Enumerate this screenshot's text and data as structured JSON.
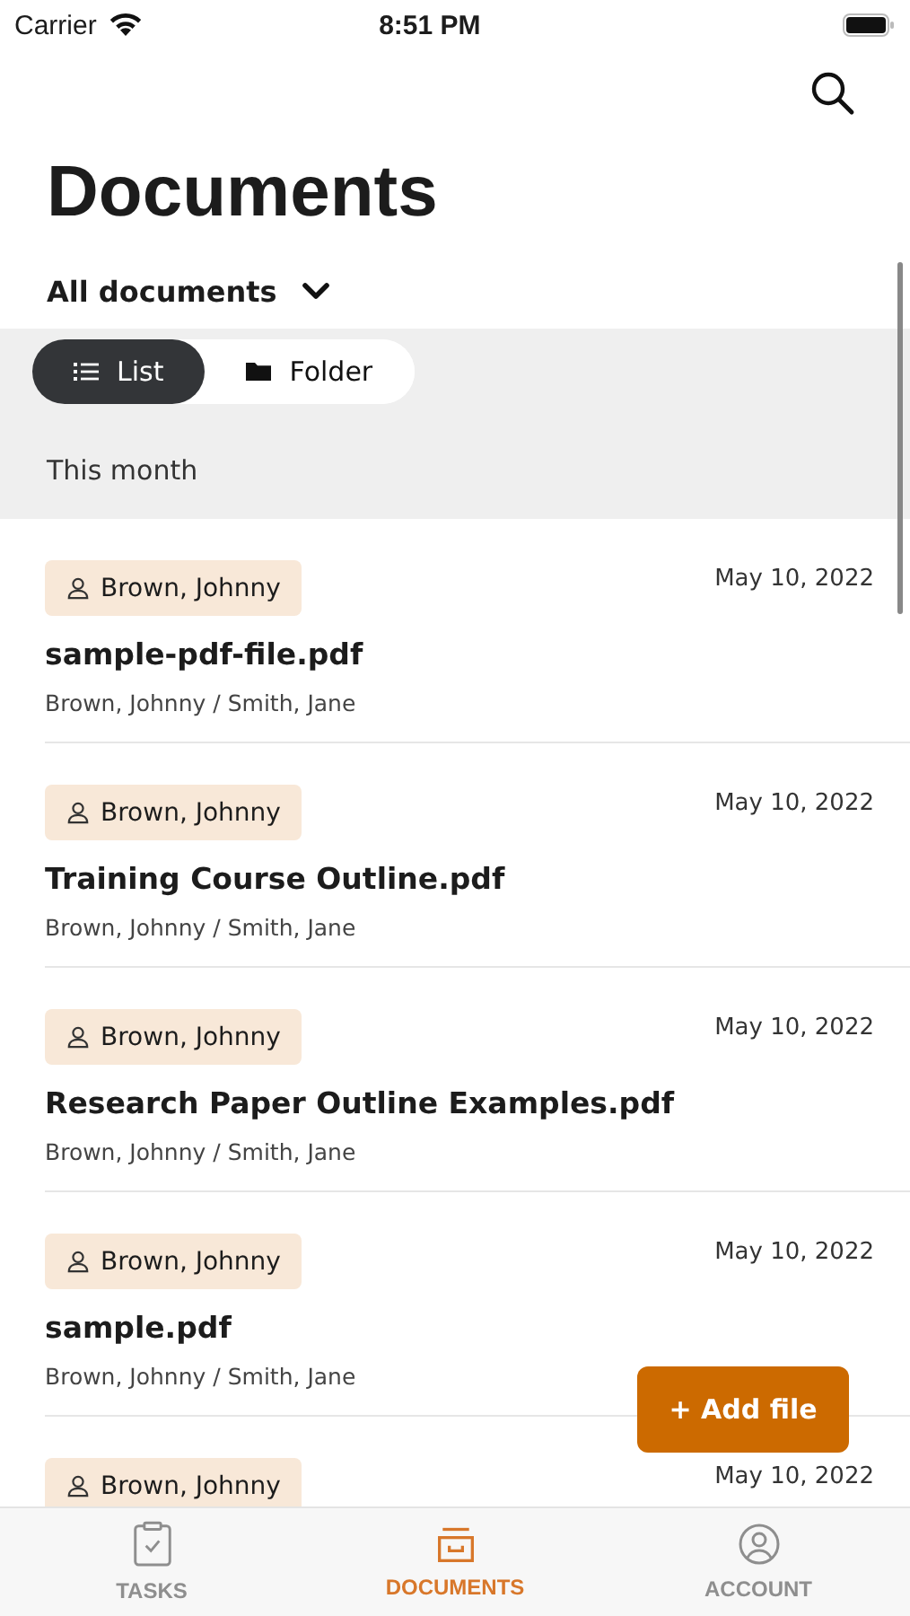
{
  "status_bar": {
    "carrier": "Carrier",
    "time": "8:51 PM"
  },
  "title": "Documents",
  "filter": {
    "label": "All documents"
  },
  "view_toggle": [
    {
      "label": "List",
      "kind": "list",
      "selected": true
    },
    {
      "label": "Folder",
      "kind": "folder",
      "selected": false
    }
  ],
  "section": "This month",
  "documents": [
    {
      "owner": "Brown, Johnny",
      "date": "May 10, 2022",
      "name": "sample-pdf-file.pdf",
      "people": "Brown, Johnny / Smith, Jane"
    },
    {
      "owner": "Brown, Johnny",
      "date": "May 10, 2022",
      "name": "Training Course Outline.pdf",
      "people": "Brown, Johnny / Smith, Jane"
    },
    {
      "owner": "Brown, Johnny",
      "date": "May 10, 2022",
      "name": "Research Paper Outline Examples.pdf",
      "people": "Brown, Johnny / Smith, Jane"
    },
    {
      "owner": "Brown, Johnny",
      "date": "May 10, 2022",
      "name": "sample.pdf",
      "people": "Brown, Johnny / Smith, Jane"
    },
    {
      "owner": "Brown, Johnny",
      "date": "May 10, 2022"
    }
  ],
  "add_button": "+ Add file",
  "tabs": [
    {
      "label": "TASKS",
      "kind": "tasks",
      "selected": false
    },
    {
      "label": "DOCUMENTS",
      "kind": "documents",
      "selected": true
    },
    {
      "label": "ACCOUNT",
      "kind": "account",
      "selected": false
    }
  ]
}
